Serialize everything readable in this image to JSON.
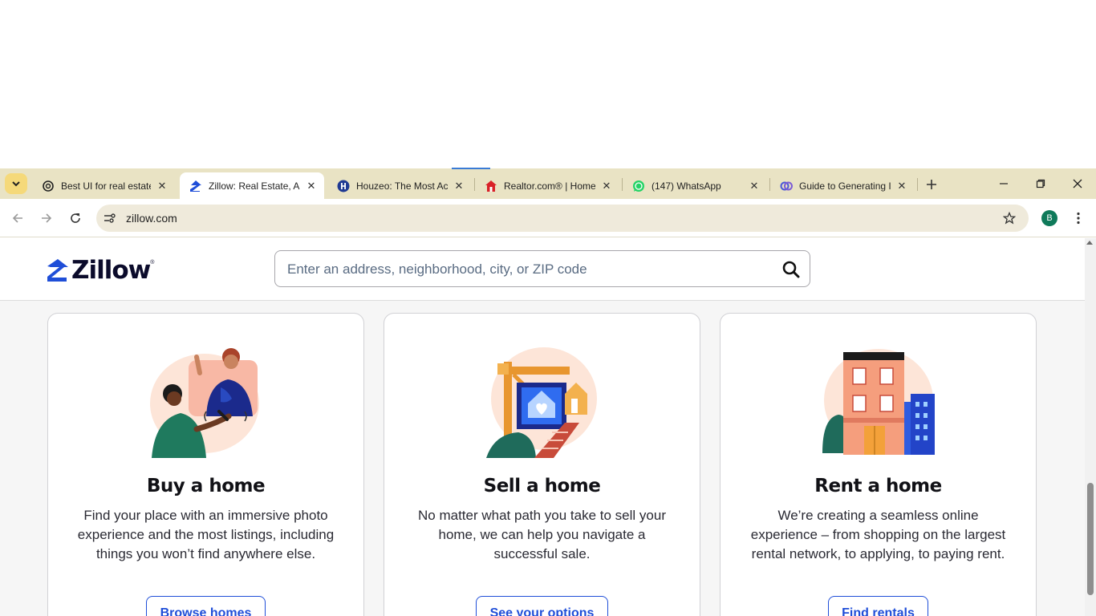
{
  "browser": {
    "tabs": [
      {
        "title": "Best UI for real estate",
        "favicon": "openai-icon"
      },
      {
        "title": "Zillow: Real Estate, Ap",
        "favicon": "zillow-icon"
      },
      {
        "title": "Houzeo: The Most Ac",
        "favicon": "houzeo-icon"
      },
      {
        "title": "Realtor.com® | Home",
        "favicon": "realtor-icon"
      },
      {
        "title": "(147) WhatsApp",
        "favicon": "whatsapp-icon"
      },
      {
        "title": "Guide to Generating I",
        "favicon": "gemini-icon"
      }
    ],
    "active_tab_index": 1,
    "url": "zillow.com",
    "profile_initial": "B",
    "colors": {
      "tabstrip": "#e9e3c4",
      "omnibox": "#efeadb",
      "avatar": "#0f7a5a"
    }
  },
  "zillow": {
    "logo_text": "Zillow",
    "logo_reg": "®",
    "search_placeholder": "Enter an address, neighborhood, city, or ZIP code",
    "accent_color": "#1f4ed8",
    "cards": [
      {
        "title": "Buy a home",
        "description": "Find your place with an immersive photo experience and the most listings, including things you won’t find anywhere else.",
        "button": "Browse homes"
      },
      {
        "title": "Sell a home",
        "description": "No matter what path you take to sell your home, we can help you navigate a successful sale.",
        "button": "See your options"
      },
      {
        "title": "Rent a home",
        "description": "We’re creating a seamless online experience – from shopping on the largest rental network, to applying, to paying rent.",
        "button": "Find rentals"
      }
    ]
  }
}
